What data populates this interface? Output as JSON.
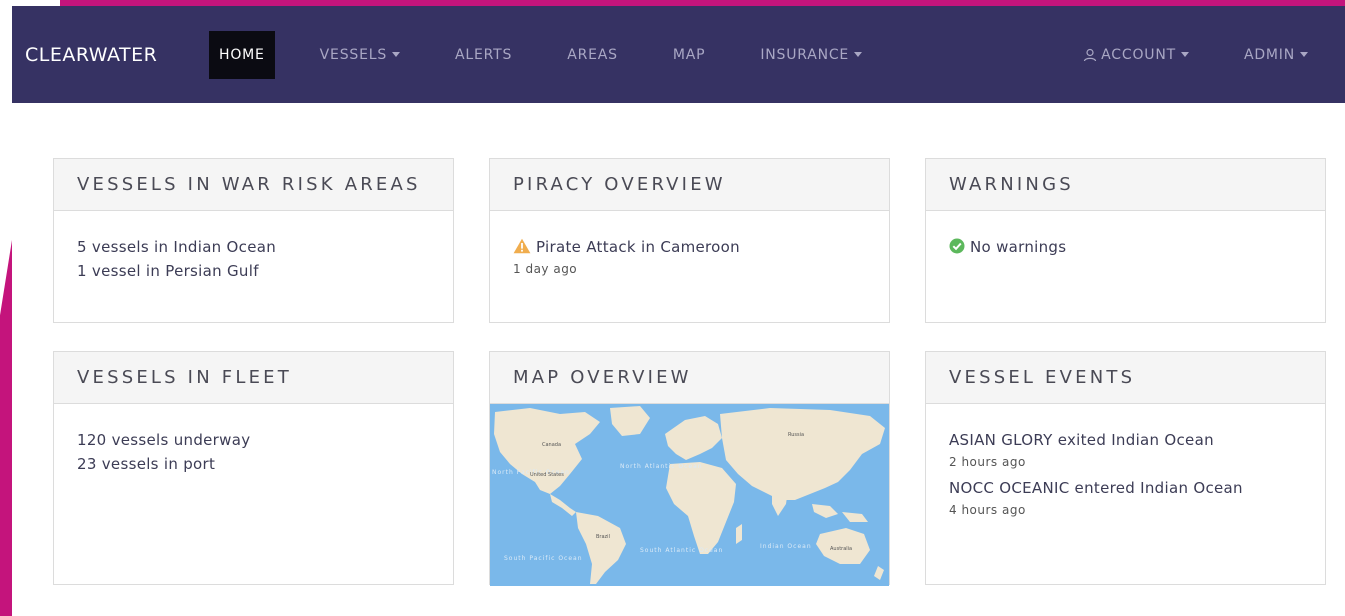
{
  "brand": "CLEARWATER",
  "nav": {
    "home": "HOME",
    "vessels": "VESSELS",
    "alerts": "ALERTS",
    "areas": "AREAS",
    "map": "MAP",
    "insurance": "INSURANCE",
    "account": "ACCOUNT",
    "admin": "ADMIN"
  },
  "cards": {
    "war_risk": {
      "title": "VESSELS IN WAR RISK AREAS",
      "lines": [
        "5 vessels in Indian Ocean",
        "1 vessel in Persian Gulf"
      ]
    },
    "piracy": {
      "title": "PIRACY OVERVIEW",
      "event": "Pirate Attack in Cameroon",
      "time": "1 day ago"
    },
    "warnings": {
      "title": "WARNINGS",
      "status": "No warnings"
    },
    "fleet": {
      "title": "VESSELS IN FLEET",
      "lines": [
        "120 vessels underway",
        "23 vessels in port"
      ]
    },
    "map": {
      "title": "MAP OVERVIEW",
      "labels": {
        "north_pacific": "North Pacific Ocean",
        "north_atlantic": "North Atlantic Ocean",
        "south_pacific": "South Pacific Ocean",
        "south_atlantic": "South Atlantic Ocean",
        "indian": "Indian Ocean",
        "russia": "Russia",
        "canada": "Canada",
        "united_states": "United States",
        "brazil": "Brazil",
        "australia": "Australia"
      }
    },
    "events": {
      "title": "VESSEL EVENTS",
      "items": [
        {
          "text": "ASIAN GLORY exited Indian Ocean",
          "time": "2 hours ago"
        },
        {
          "text": "NOCC OCEANIC entered Indian Ocean",
          "time": "4 hours ago"
        }
      ]
    }
  },
  "colors": {
    "navbar": "#363263",
    "accent": "#c4147c",
    "warning": "#f0ad4e",
    "success": "#5cb85c",
    "ocean": "#7ab8ea",
    "land": "#efe6d2"
  }
}
